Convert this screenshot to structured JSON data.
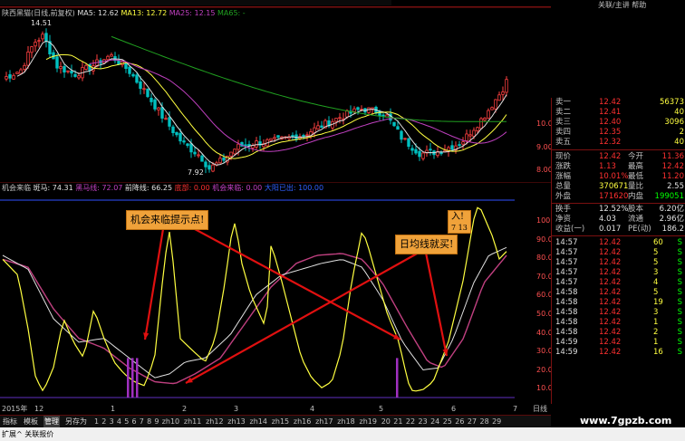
{
  "menu": {
    "right_text": "关联/主讲 帮助"
  },
  "kline": {
    "title": "陕西黑猫(日线,前复权)",
    "ma5": "MA5: 12.62",
    "ma13": "MA13: 12.72",
    "ma25": "MA25: 12.15",
    "ma65": "MA65: -",
    "high_label": "14.51",
    "low_label": "7.92",
    "y_ticks": [
      "10.00",
      "9.00",
      "8.00"
    ]
  },
  "indicator": {
    "name": "机会来临",
    "ma_label": "斑马: 74.31",
    "line1": "黑马线: 72.07",
    "line2": "前降线: 66.25",
    "line3": "底部: 0.00",
    "line4": "机会来临: 0.00",
    "line5": "大阳已出: 100.00",
    "y_ticks": [
      "100.00",
      "90.00",
      "80.00",
      "70.00",
      "60.00",
      "50.00",
      "40.00",
      "30.00",
      "20.00",
      "10.00"
    ]
  },
  "callouts": {
    "left": "机会来临提示点!",
    "right_top": "入!",
    "right_top_sub": "7 13",
    "right": "日均线就买!"
  },
  "x_axis": {
    "year": "2015年",
    "labels": [
      "12",
      "1",
      "2",
      "3",
      "4",
      "5",
      "6",
      "7"
    ],
    "period": "日线"
  },
  "quote": {
    "sell": [
      {
        "label": "卖一",
        "price": "12.42",
        "vol": "56373"
      },
      {
        "label": "卖二",
        "price": "12.41",
        "vol": "40"
      },
      {
        "label": "卖三",
        "price": "12.40",
        "vol": "3096"
      },
      {
        "label": "卖四",
        "price": "12.35",
        "vol": "2"
      },
      {
        "label": "卖五",
        "price": "12.32",
        "vol": "40"
      }
    ],
    "stats": [
      {
        "l1": "现价",
        "v1": "12.42",
        "l2": "今开",
        "v2": "11.36"
      },
      {
        "l1": "涨跌",
        "v1": "1.13",
        "l2": "最高",
        "v2": "12.42"
      },
      {
        "l1": "涨幅",
        "v1": "10.01%",
        "l2": "最低",
        "v2": "11.20"
      },
      {
        "l1": "总量",
        "v1": "370671",
        "l2": "量比",
        "v2": "2.55"
      },
      {
        "l1": "外盘",
        "v1": "171620",
        "l2": "内盘",
        "v2": "199051"
      },
      {
        "l1": "换手",
        "v1": "12.52%",
        "l2": "股本",
        "v2": "6.20亿"
      },
      {
        "l1": "净资",
        "v1": "4.03",
        "l2": "流通",
        "v2": "2.96亿"
      },
      {
        "l1": "收益(一)",
        "v1": "0.017",
        "l2": "PE(动)",
        "v2": "186.2"
      }
    ],
    "ticks": [
      {
        "time": "14:57",
        "price": "12.42",
        "vol": "60",
        "side": "S"
      },
      {
        "time": "14:57",
        "price": "12.42",
        "vol": "5",
        "side": "S"
      },
      {
        "time": "14:57",
        "price": "12.42",
        "vol": "5",
        "side": "S"
      },
      {
        "time": "14:57",
        "price": "12.42",
        "vol": "3",
        "side": "S"
      },
      {
        "time": "14:57",
        "price": "12.42",
        "vol": "4",
        "side": "S"
      },
      {
        "time": "14:58",
        "price": "12.42",
        "vol": "5",
        "side": "S"
      },
      {
        "time": "14:58",
        "price": "12.42",
        "vol": "19",
        "side": "S"
      },
      {
        "time": "14:58",
        "price": "12.42",
        "vol": "3",
        "side": "S"
      },
      {
        "time": "14:58",
        "price": "12.42",
        "vol": "1",
        "side": "S"
      },
      {
        "time": "14:58",
        "price": "12.42",
        "vol": "2",
        "side": "S"
      },
      {
        "time": "14:59",
        "price": "12.42",
        "vol": "1",
        "side": "S"
      },
      {
        "time": "14:59",
        "price": "12.42",
        "vol": "16",
        "side": "S"
      }
    ]
  },
  "tabs": {
    "items": [
      "指标",
      "模板",
      "管理",
      "另存为"
    ],
    "active": "管理",
    "nums": [
      "1",
      "2",
      "3",
      "4",
      "5",
      "6",
      "7",
      "8",
      "9",
      "zh10",
      "zh11",
      "zh12",
      "zh13",
      "zh14",
      "zh15",
      "zh16",
      "zh17",
      "zh18",
      "zh19",
      "20",
      "21",
      "22",
      "23",
      "24",
      "25",
      "26",
      "27",
      "28",
      "29"
    ]
  },
  "status": {
    "tab": "扩展^ 关联报价"
  },
  "watermark": "www.7gpzb.com",
  "colors": {
    "up": "#ff4040",
    "down": "#00c0c0",
    "yellow": "#ffff40",
    "white": "#e0e0e0",
    "magenta": "#c040c0",
    "green": "#20a020",
    "label_red": "#ff3030"
  }
}
